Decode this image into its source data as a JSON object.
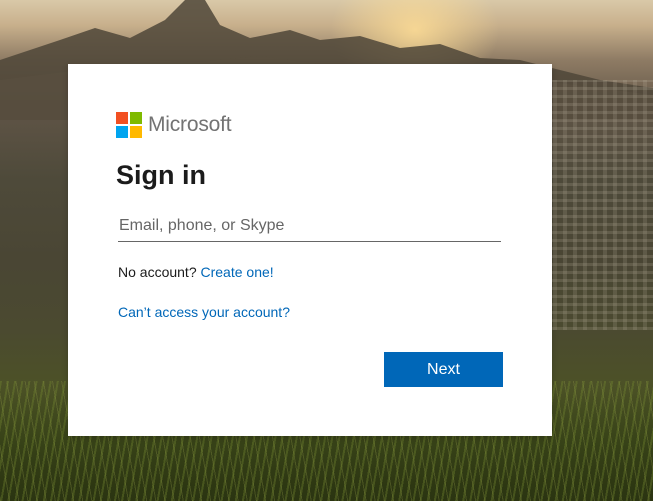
{
  "brand": {
    "name": "Microsoft",
    "logo_colors": [
      "#f25022",
      "#7fba00",
      "#00a4ef",
      "#ffb900"
    ]
  },
  "signin": {
    "title": "Sign in",
    "email_placeholder": "Email, phone, or Skype",
    "email_value": "",
    "no_account_text": "No account?",
    "create_link": "Create one!",
    "cant_access_link": "Can’t access your account?",
    "next_label": "Next"
  },
  "colors": {
    "accent": "#0067b8",
    "brand_text": "#737373",
    "text": "#1b1b1b"
  }
}
